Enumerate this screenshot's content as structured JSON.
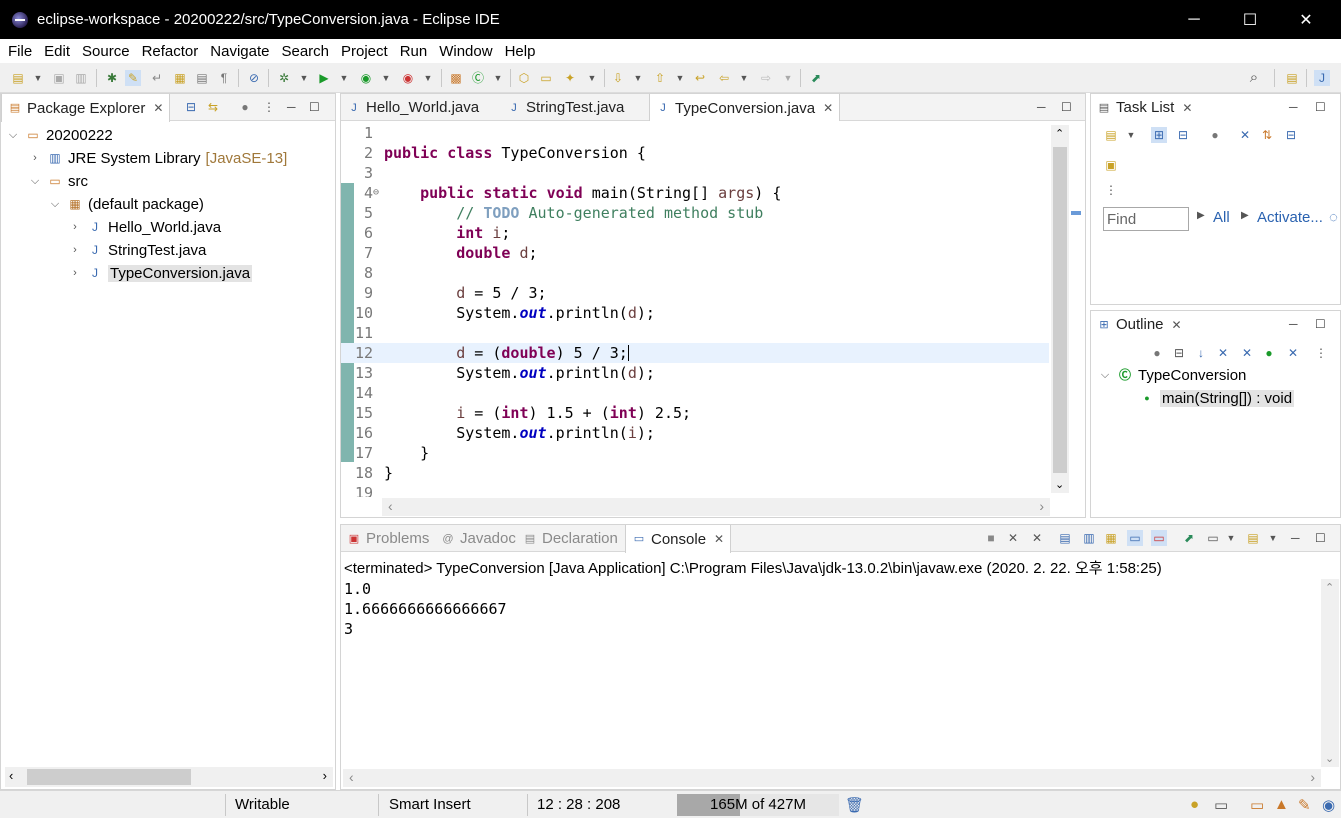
{
  "window": {
    "title": "eclipse-workspace - 20200222/src/TypeConversion.java - Eclipse IDE",
    "app_icon": "eclipse-icon",
    "controls": {
      "minimize": "─",
      "maximize": "☐",
      "close": "✕"
    }
  },
  "menu": [
    "File",
    "Edit",
    "Source",
    "Refactor",
    "Navigate",
    "Search",
    "Project",
    "Run",
    "Window",
    "Help"
  ],
  "package_explorer": {
    "tab_label": "Package Explorer",
    "tree": [
      {
        "label": "20200222",
        "icon": "project-folder-icon",
        "expanded": true
      },
      {
        "label": "JRE System Library",
        "decoration": "[JavaSE-13]",
        "icon": "library-icon",
        "expanded": false
      },
      {
        "label": "src",
        "icon": "source-folder-icon",
        "expanded": true
      },
      {
        "label": "(default package)",
        "icon": "package-icon",
        "expanded": true
      },
      {
        "label": "Hello_World.java",
        "icon": "java-file-icon",
        "expanded": false
      },
      {
        "label": "StringTest.java",
        "icon": "java-file-icon",
        "expanded": false
      },
      {
        "label": "TypeConversion.java",
        "icon": "java-file-icon",
        "expanded": false,
        "selected": true
      }
    ]
  },
  "editor": {
    "tabs": [
      {
        "label": "Hello_World.java",
        "active": false
      },
      {
        "label": "StringTest.java",
        "active": false
      },
      {
        "label": "TypeConversion.java",
        "active": true
      }
    ],
    "current_line": 12,
    "lines": [
      {
        "n": "1",
        "text": ""
      },
      {
        "n": "2",
        "text": "public class TypeConversion {"
      },
      {
        "n": "3",
        "text": ""
      },
      {
        "n": "4",
        "text": "    public static void main(String[] args) {"
      },
      {
        "n": "5",
        "text": "        // TODO Auto-generated method stub"
      },
      {
        "n": "6",
        "text": "        int i;"
      },
      {
        "n": "7",
        "text": "        double d;"
      },
      {
        "n": "8",
        "text": ""
      },
      {
        "n": "9",
        "text": "        d = 5 / 3;"
      },
      {
        "n": "10",
        "text": "        System.out.println(d);"
      },
      {
        "n": "11",
        "text": ""
      },
      {
        "n": "12",
        "text": "        d = (double) 5 / 3;"
      },
      {
        "n": "13",
        "text": "        System.out.println(d);"
      },
      {
        "n": "14",
        "text": ""
      },
      {
        "n": "15",
        "text": "        i = (int) 1.5 + (int) 2.5;"
      },
      {
        "n": "16",
        "text": "        System.out.println(i);"
      },
      {
        "n": "17",
        "text": "    }"
      },
      {
        "n": "18",
        "text": "}"
      },
      {
        "n": "19",
        "text": ""
      }
    ]
  },
  "task_list": {
    "tab_label": "Task List",
    "find_placeholder": "Find",
    "all_label": "All",
    "activate_label": "Activate..."
  },
  "outline": {
    "tab_label": "Outline",
    "items": [
      {
        "label": "TypeConversion",
        "icon": "class-icon"
      },
      {
        "label": "main(String[]) : void",
        "icon": "public-method-icon",
        "selected": true
      }
    ]
  },
  "console": {
    "tabs": [
      {
        "label": "Problems",
        "active": false
      },
      {
        "label": "Javadoc",
        "active": false
      },
      {
        "label": "Declaration",
        "active": false
      },
      {
        "label": "Console",
        "active": true
      }
    ],
    "header": "<terminated> TypeConversion [Java Application] C:\\Program Files\\Java\\jdk-13.0.2\\bin\\javaw.exe (2020. 2. 22. 오후 1:58:25)",
    "output": [
      "1.0",
      "1.6666666666666667",
      "3"
    ]
  },
  "status": {
    "writable": "Writable",
    "insert_mode": "Smart Insert",
    "position": "12 : 28 : 208",
    "heap": "165M of 427M",
    "heap_used_fraction": 0.386
  }
}
